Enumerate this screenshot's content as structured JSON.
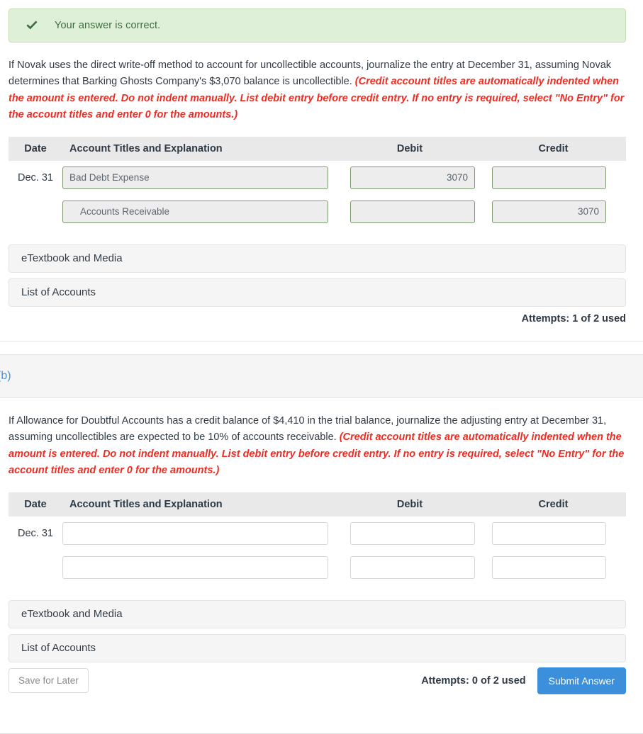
{
  "alert": {
    "icon": "check-icon",
    "message": "Your answer is correct."
  },
  "part_a": {
    "question_main": "If Novak uses the direct write-off method to account for uncollectible accounts, journalize the entry at December 31, assuming Novak determines that Barking Ghosts Company's $3,070 balance is uncollectible. ",
    "question_hint": "(Credit account titles are automatically indented when the amount is entered. Do not indent manually. List debit entry before credit entry. If no entry is required, select \"No Entry\" for the account titles and enter 0 for the amounts.)",
    "table": {
      "headers": {
        "date": "Date",
        "account": "Account Titles and Explanation",
        "debit": "Debit",
        "credit": "Credit"
      },
      "rows": [
        {
          "date": "Dec. 31",
          "account": "Bad Debt Expense",
          "account_indent": false,
          "debit": "3070",
          "credit": "",
          "state": "answered"
        },
        {
          "date": "",
          "account": "Accounts Receivable",
          "account_indent": true,
          "debit": "",
          "credit": "3070",
          "state": "answered"
        }
      ]
    },
    "etextbook_label": "eTextbook and Media",
    "list_of_accounts_label": "List of Accounts",
    "attempts": "Attempts: 1 of 2 used"
  },
  "part_b": {
    "label": "(b)",
    "question_main": "If Allowance for Doubtful Accounts has a credit balance of $4,410 in the trial balance, journalize the adjusting entry at December 31, assuming uncollectibles are expected to be 10% of accounts receivable. ",
    "question_hint": "(Credit account titles are automatically indented when the amount is entered. Do not indent manually. List debit entry before credit entry. If no entry is required, select \"No Entry\" for the account titles and enter 0 for the amounts.)",
    "table": {
      "headers": {
        "date": "Date",
        "account": "Account Titles and Explanation",
        "debit": "Debit",
        "credit": "Credit"
      },
      "rows": [
        {
          "date": "Dec. 31",
          "account": "",
          "account_indent": false,
          "debit": "",
          "credit": "",
          "state": "blank"
        },
        {
          "date": "",
          "account": "",
          "account_indent": false,
          "debit": "",
          "credit": "",
          "state": "blank"
        }
      ]
    },
    "etextbook_label": "eTextbook and Media",
    "list_of_accounts_label": "List of Accounts",
    "attempts": "Attempts: 0 of 2 used",
    "save_label": "Save for Later",
    "submit_label": "Submit Answer"
  },
  "colors": {
    "success_bg": "#dff0d8",
    "success_text": "#3c6e3c",
    "hint_red": "#ef2b22",
    "accent_blue": "#3b8fdb",
    "answered_border": "#7e9a6f",
    "header_bg": "#e9e9e9"
  }
}
